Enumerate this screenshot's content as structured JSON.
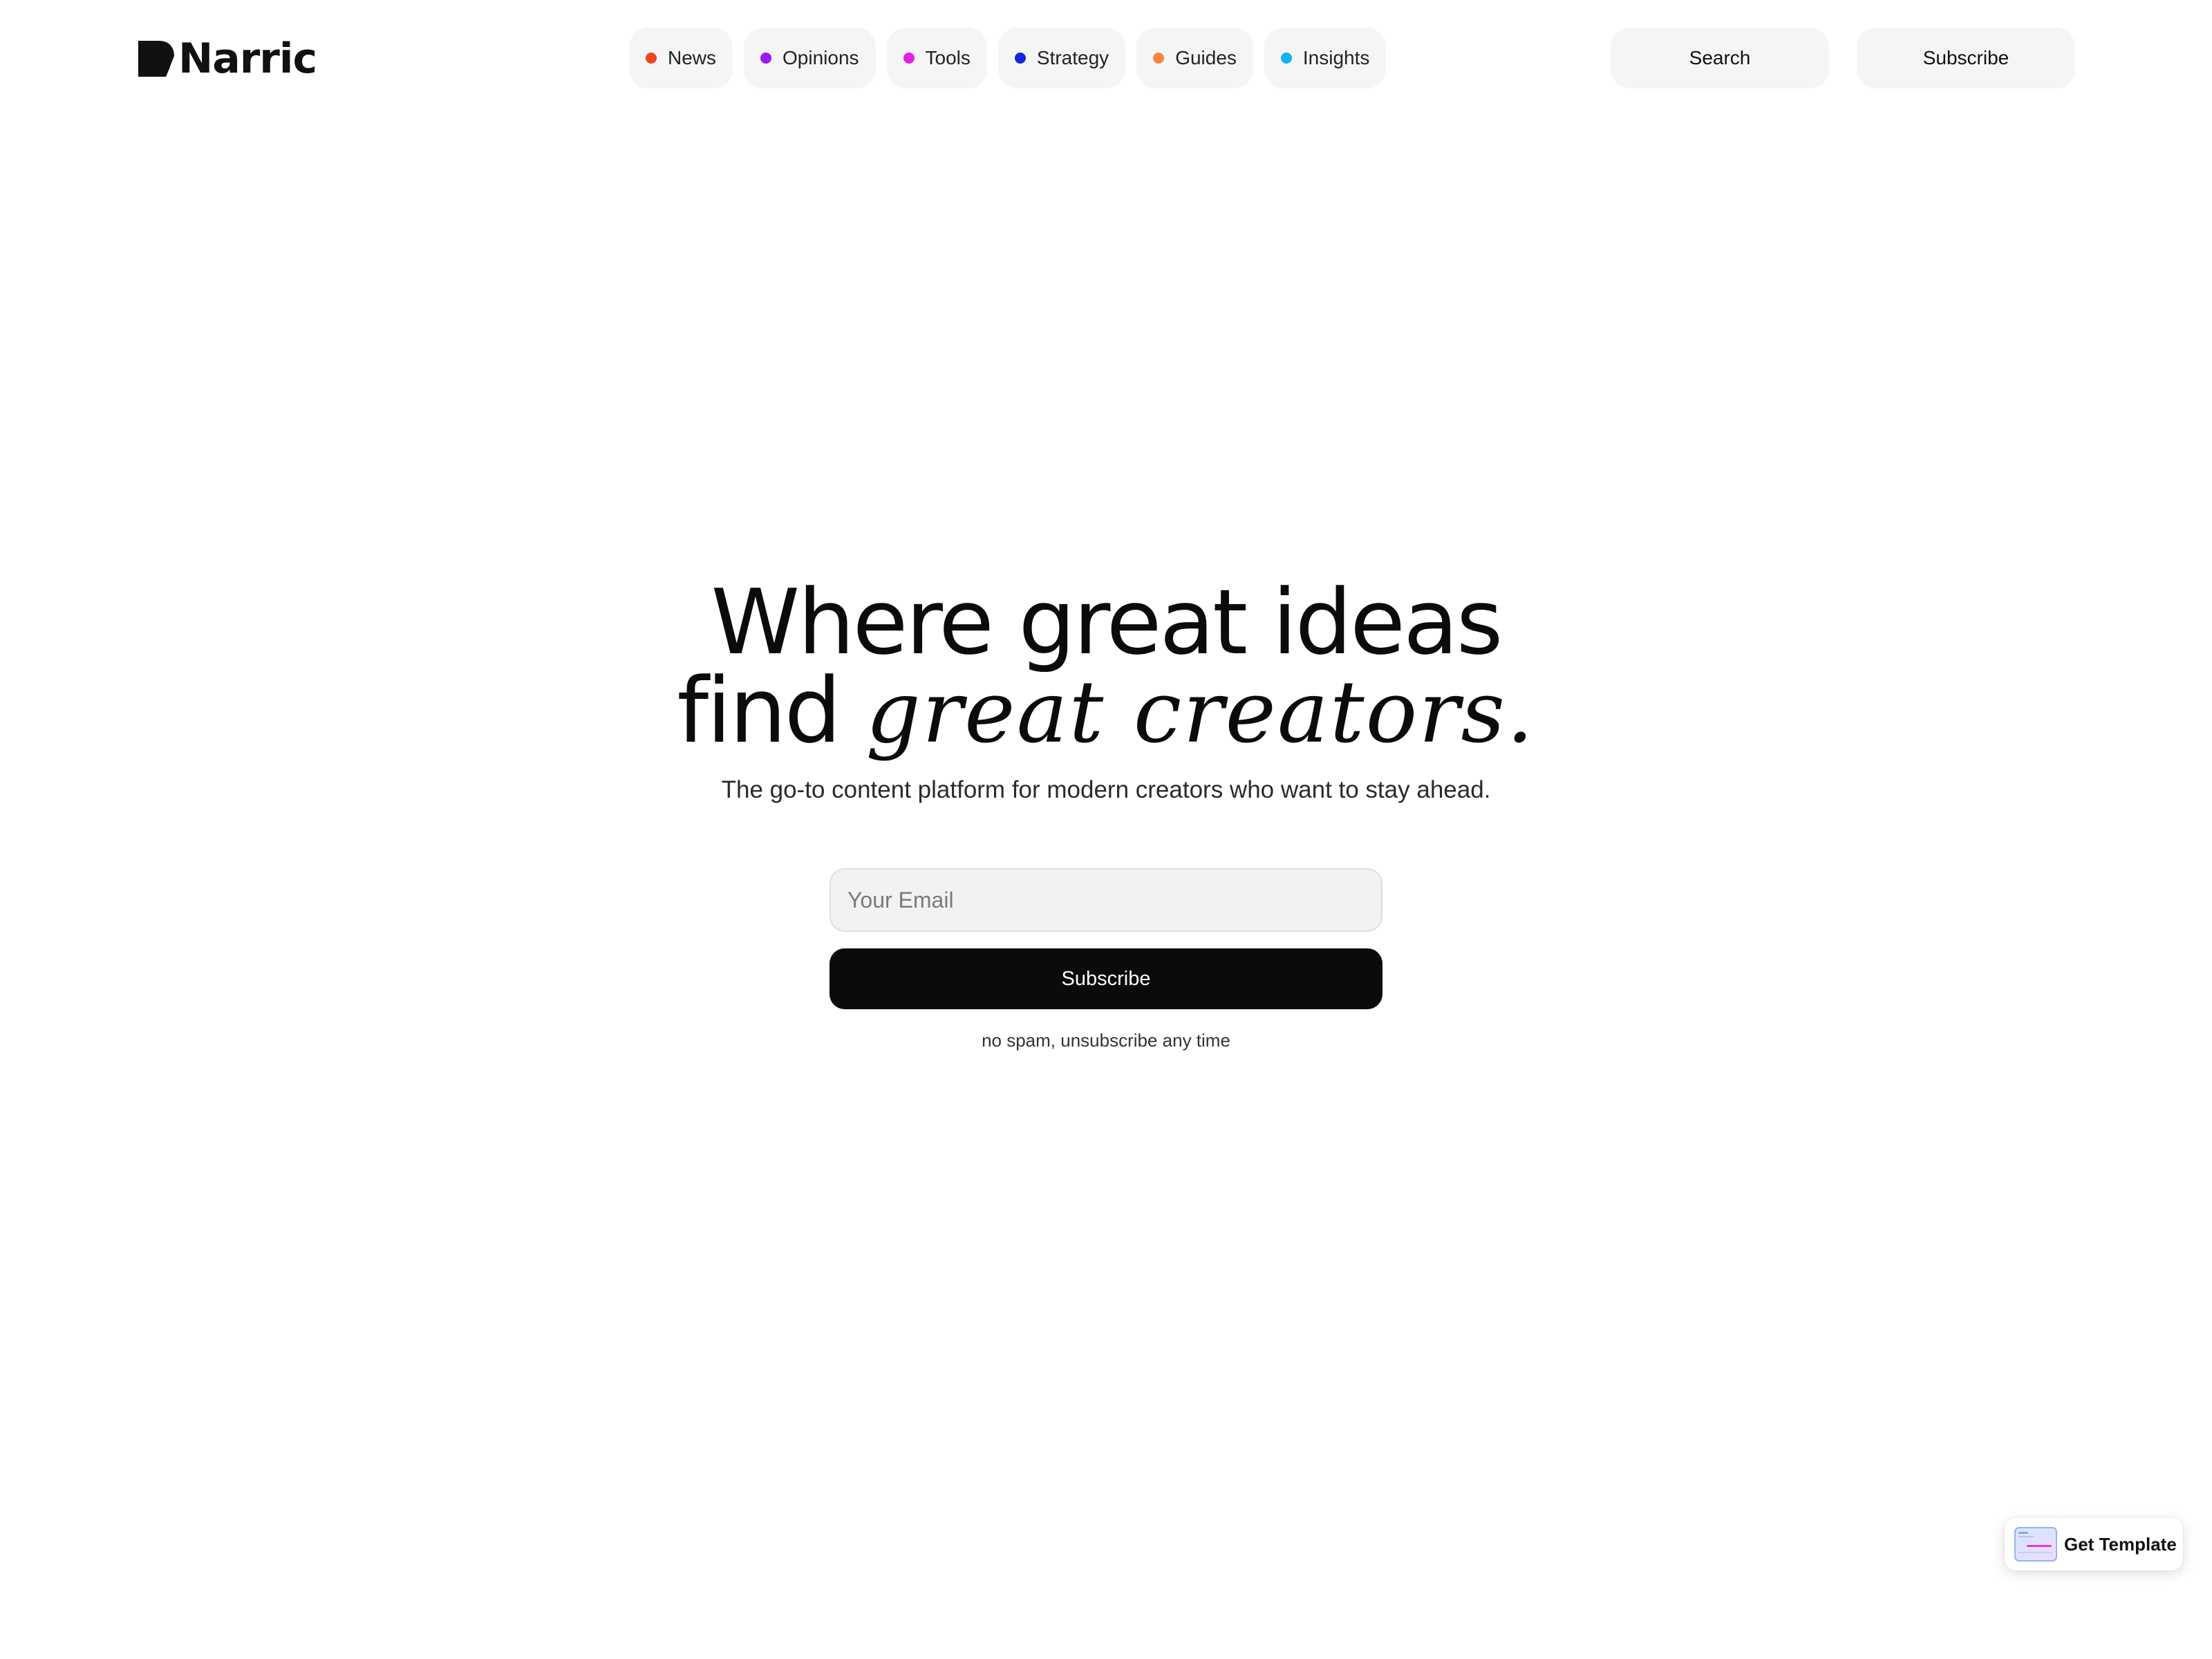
{
  "brand": {
    "name": "Narric",
    "logo_icon": "narric-logo-mark"
  },
  "nav": {
    "items": [
      {
        "label": "News",
        "dot_color": "#f0461e"
      },
      {
        "label": "Opinions",
        "dot_color": "#9b17f2"
      },
      {
        "label": "Tools",
        "dot_color": "#e61ee6"
      },
      {
        "label": "Strategy",
        "dot_color": "#1028e0"
      },
      {
        "label": "Guides",
        "dot_color": "#f5883c"
      },
      {
        "label": "Insights",
        "dot_color": "#10b4ee"
      }
    ],
    "search_label": "Search",
    "subscribe_label": "Subscribe"
  },
  "hero": {
    "headline_line1": "Where great ideas",
    "headline_line2_plain": "find",
    "headline_line2_italic": "great creators.",
    "subtitle": "The go-to content platform for modern creators who want to stay ahead."
  },
  "form": {
    "email_placeholder": "Your Email",
    "email_value": "",
    "subscribe_label": "Subscribe",
    "fine_print": "no spam, unsubscribe any time"
  },
  "badge": {
    "label": "Get Template",
    "icon": "template-preview-icon"
  },
  "colors": {
    "accent": "#0b0b0b",
    "pill_background": "#f5f5f5"
  }
}
